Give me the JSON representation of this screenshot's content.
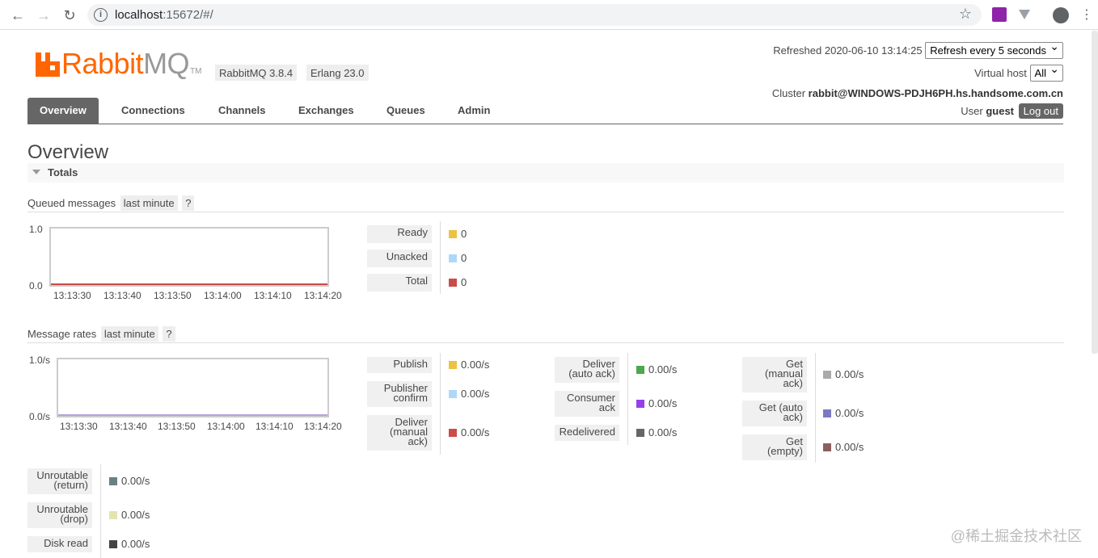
{
  "browser": {
    "url_host": "localhost",
    "url_rest": ":15672/#/"
  },
  "header": {
    "logo_rabbit": "Rabbit",
    "logo_mq": "MQ",
    "logo_tm": "TM",
    "version_rabbit": "RabbitMQ 3.8.4",
    "version_erlang": "Erlang 23.0",
    "refreshed": "Refreshed 2020-06-10 13:14:25",
    "refresh_select": "Refresh every 5 seconds",
    "vhost_label": "Virtual host",
    "vhost_select": "All",
    "cluster_label": "Cluster",
    "cluster_name": "rabbit@WINDOWS-PDJH6PH.hs.handsome.com.cn",
    "user_label": "User",
    "user_name": "guest",
    "logout": "Log out"
  },
  "tabs": [
    "Overview",
    "Connections",
    "Channels",
    "Exchanges",
    "Queues",
    "Admin"
  ],
  "page_title": "Overview",
  "totals_label": "Totals",
  "queued": {
    "label": "Queued messages",
    "range": "last minute",
    "help": "?",
    "y_top": "1.0",
    "y_bottom": "0.0",
    "x_ticks": [
      "13:13:30",
      "13:13:40",
      "13:13:50",
      "13:14:00",
      "13:14:10",
      "13:14:20"
    ],
    "legend": [
      {
        "label": "Ready",
        "value": "0",
        "color": "#edc240"
      },
      {
        "label": "Unacked",
        "value": "0",
        "color": "#afd8f8"
      },
      {
        "label": "Total",
        "value": "0",
        "color": "#cb4b4b"
      }
    ]
  },
  "rates": {
    "label": "Message rates",
    "range": "last minute",
    "help": "?",
    "y_top": "1.0/s",
    "y_bottom": "0.0/s",
    "x_ticks": [
      "13:13:30",
      "13:13:40",
      "13:13:50",
      "13:14:00",
      "13:14:10",
      "13:14:20"
    ],
    "col1": [
      {
        "label": "Publish",
        "value": "0.00/s",
        "color": "#edc240"
      },
      {
        "label": "Publisher\nconfirm",
        "value": "0.00/s",
        "color": "#afd8f8"
      },
      {
        "label": "Deliver\n(manual\nack)",
        "value": "0.00/s",
        "color": "#cb4b4b"
      }
    ],
    "col2": [
      {
        "label": "Deliver\n(auto ack)",
        "value": "0.00/s",
        "color": "#4da74d"
      },
      {
        "label": "Consumer\nack",
        "value": "0.00/s",
        "color": "#9440ed"
      },
      {
        "label": "Redelivered",
        "value": "0.00/s",
        "color": "#666666"
      }
    ],
    "col3": [
      {
        "label": "Get\n(manual\nack)",
        "value": "0.00/s",
        "color": "#aaaaaa"
      },
      {
        "label": "Get (auto\nack)",
        "value": "0.00/s",
        "color": "#7c79c3"
      },
      {
        "label": "Get\n(empty)",
        "value": "0.00/s",
        "color": "#8d5e5e"
      }
    ],
    "col4": [
      {
        "label": "Unroutable\n(return)",
        "value": "0.00/s",
        "color": "#6b7f87"
      },
      {
        "label": "Unroutable\n(drop)",
        "value": "0.00/s",
        "color": "#e3e5b0"
      },
      {
        "label": "Disk read",
        "value": "0.00/s",
        "color": "#444444"
      }
    ]
  },
  "watermark": "@稀土掘金技术社区"
}
